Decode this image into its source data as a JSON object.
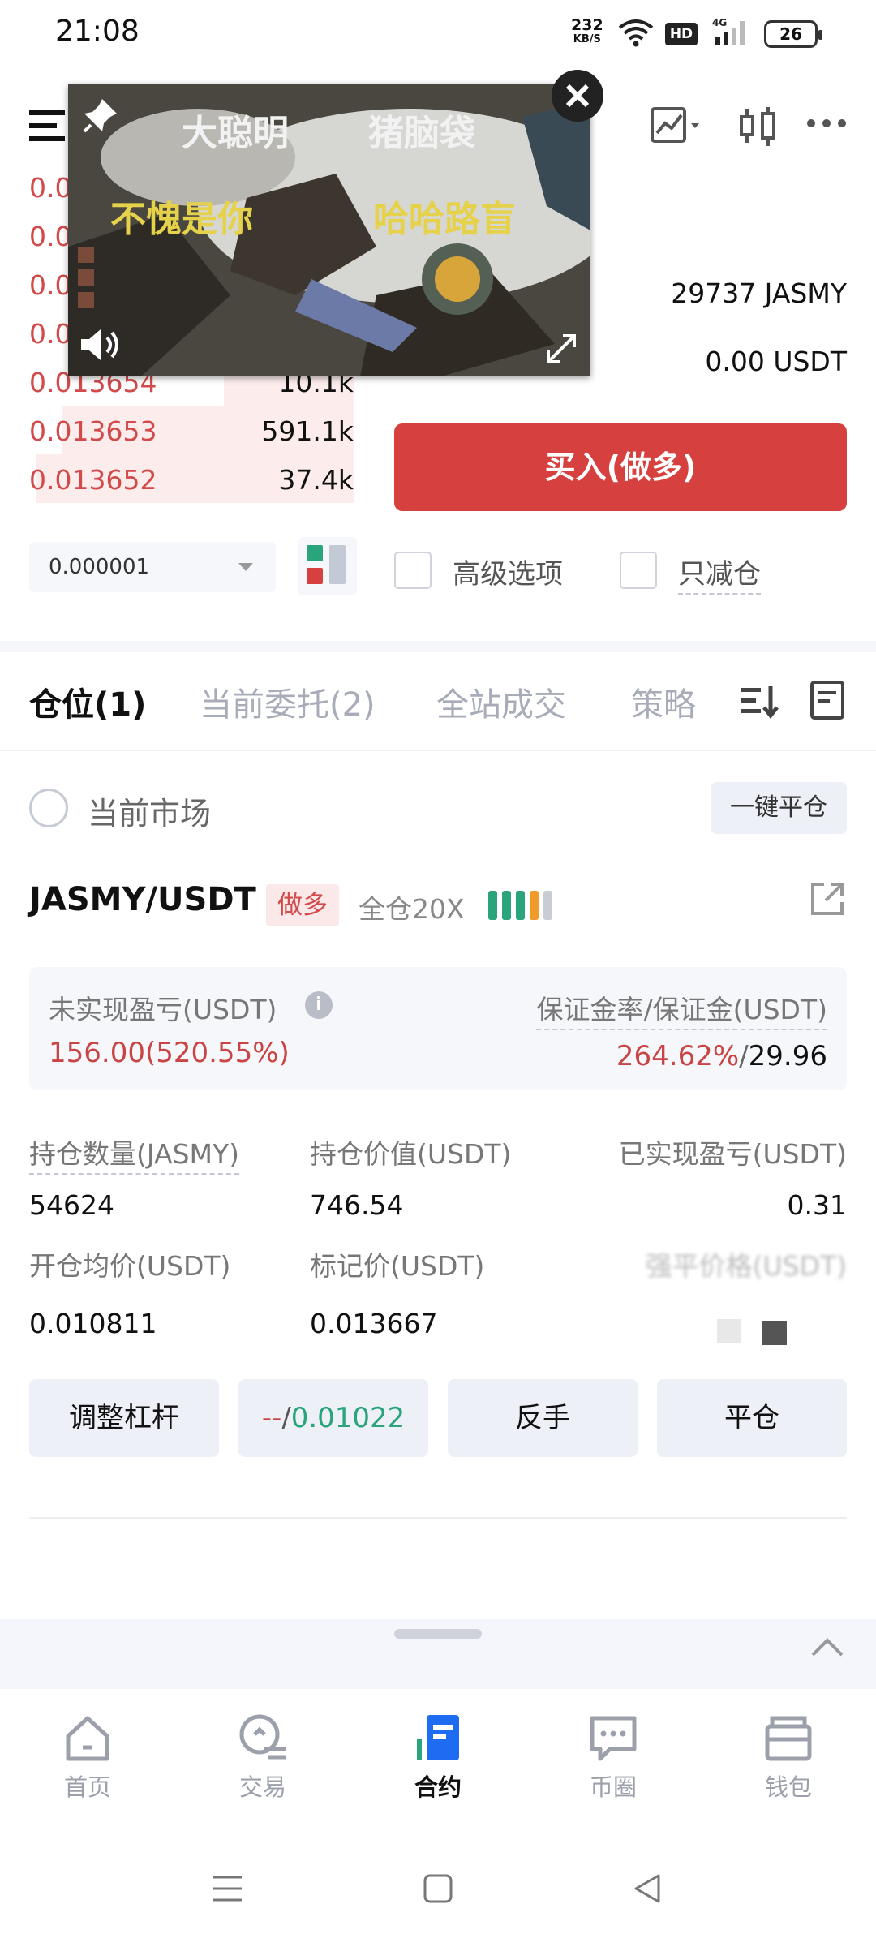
{
  "status_bar": {
    "time": "21:08",
    "net_speed_value": "232",
    "net_speed_unit": "KB/S",
    "hd": "HD",
    "network": "4G",
    "battery": "26"
  },
  "order_book": {
    "rows": [
      {
        "price": "0.0",
        "qty": ""
      },
      {
        "price": "0.0",
        "qty": ""
      },
      {
        "price": "0.0",
        "qty": ""
      },
      {
        "price": "0.0",
        "qty": ""
      },
      {
        "price": "0.013654",
        "qty": "10.1k"
      },
      {
        "price": "0.013653",
        "qty": "591.1k"
      },
      {
        "price": "0.013652",
        "qty": "37.4k"
      }
    ],
    "depth_fill": [
      0.1,
      0.15,
      0.2,
      0.25,
      0.4,
      0.9,
      0.98
    ],
    "tick_size": "0.000001"
  },
  "trade": {
    "available_jasmy": "29737 JASMY",
    "available_usdt": "0.00 USDT",
    "buy_label": "买入(做多)",
    "advanced_label": "高级选项",
    "reduce_only_label": "只减仓"
  },
  "tabs": [
    {
      "label": "仓位(1)"
    },
    {
      "label": "当前委托(2)"
    },
    {
      "label": "全站成交"
    },
    {
      "label": "策略"
    }
  ],
  "positions": {
    "current_market": "当前市场",
    "close_all": "一键平仓",
    "pair": "JASMY/USDT",
    "side": "做多",
    "leverage": "全仓20X",
    "risk_level": 4,
    "unrealized_label": "未实现盈亏(USDT)",
    "unrealized_value": "156.00(520.55%)",
    "margin_label": "保证金率/保证金(USDT)",
    "margin_ratio": "264.62%",
    "margin_sep": "/",
    "margin_value": "29.96",
    "qty_label": "持仓数量(JASMY)",
    "qty_value": "54624",
    "value_label": "持仓价值(USDT)",
    "value_value": "746.54",
    "realized_label": "已实现盈亏(USDT)",
    "realized_value": "0.31",
    "entry_label": "开仓均价(USDT)",
    "entry_value": "0.010811",
    "mark_label": "标记价(USDT)",
    "mark_value": "0.013667",
    "liq_label": "强平价格(USDT)",
    "btn_leverage": "调整杠杆",
    "btn_tp": "--",
    "btn_sep": "/",
    "btn_sl": "0.01022",
    "btn_reverse": "反手",
    "btn_close": "平仓"
  },
  "colors": {
    "red": "#d6413f",
    "green": "#2aa47b",
    "accent": "#1e6cf2"
  },
  "video": {
    "text_1": "大聪明",
    "text_2": "猪脑袋",
    "text_3": "不愧是你",
    "text_4": "哈哈路盲"
  },
  "nav": [
    {
      "label": "首页",
      "icon": "home-icon"
    },
    {
      "label": "交易",
      "icon": "trade-icon"
    },
    {
      "label": "合约",
      "icon": "contract-icon"
    },
    {
      "label": "币圈",
      "icon": "chat-icon"
    },
    {
      "label": "钱包",
      "icon": "wallet-icon"
    }
  ]
}
